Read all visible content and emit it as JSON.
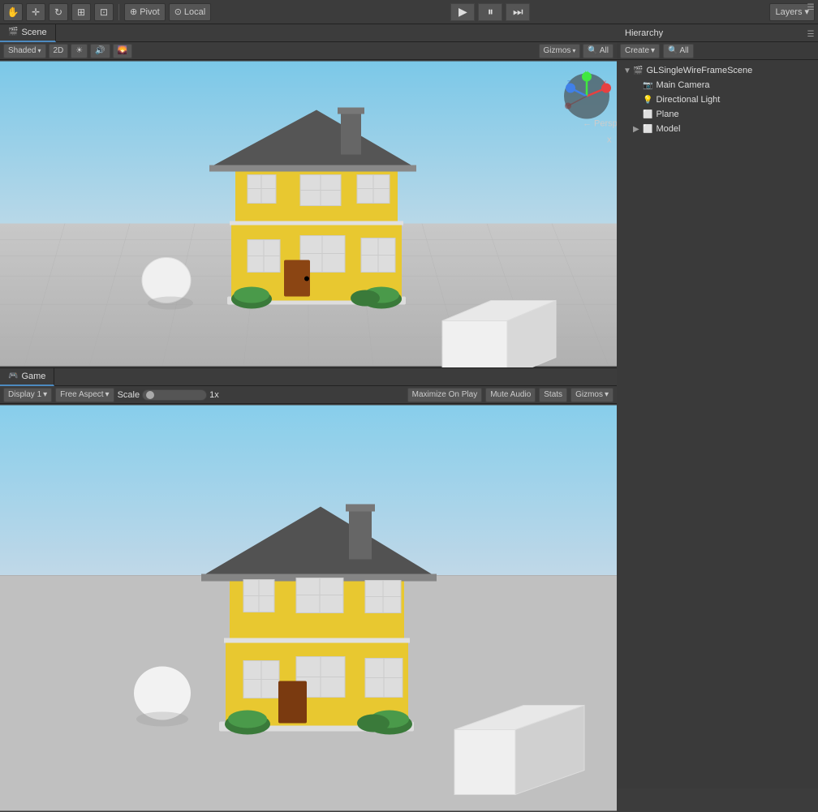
{
  "toolbar": {
    "tools": [
      "hand",
      "move",
      "refresh",
      "rect-tool",
      "scale-tool"
    ],
    "pivot_label": "Pivot",
    "local_label": "Local",
    "play_btn": "▶",
    "pause_btn": "⏸",
    "step_btn": "⏭",
    "layers_btn": "Layers"
  },
  "scene_view": {
    "tab_label": "Scene",
    "shading_label": "Shaded",
    "toolbar_2d": "2D",
    "gizmos_label": "Gizmos",
    "all_label": "All",
    "persp_label": "← Persp"
  },
  "game_view": {
    "tab_label": "Game",
    "display_label": "Display 1",
    "aspect_label": "Free Aspect",
    "scale_label": "Scale",
    "scale_value": "1x",
    "maximize_label": "Maximize On Play",
    "mute_label": "Mute Audio",
    "stats_label": "Stats",
    "gizmos_label": "Gizmos"
  },
  "hierarchy": {
    "tab_label": "Hierarchy",
    "create_label": "Create",
    "all_label": "All",
    "scene_name": "GLSingleWireFrameScene",
    "items": [
      {
        "label": "Main Camera",
        "indent": 2,
        "icon": "📷"
      },
      {
        "label": "Directional Light",
        "indent": 2,
        "icon": "💡"
      },
      {
        "label": "Plane",
        "indent": 2,
        "icon": "▣"
      },
      {
        "label": "Model",
        "indent": 2,
        "icon": "▶",
        "expandable": true
      }
    ]
  },
  "colors": {
    "sky_top": "#87CEEB",
    "sky_bottom": "#b0c8d8",
    "ground": "#b8b8b8",
    "house_body": "#E8C830",
    "house_roof": "#555555",
    "house_trim": "#dddddd",
    "accent_blue": "#4d8ac0",
    "toolbar_bg": "#3c3c3c",
    "panel_bg": "#3a3a3a"
  }
}
